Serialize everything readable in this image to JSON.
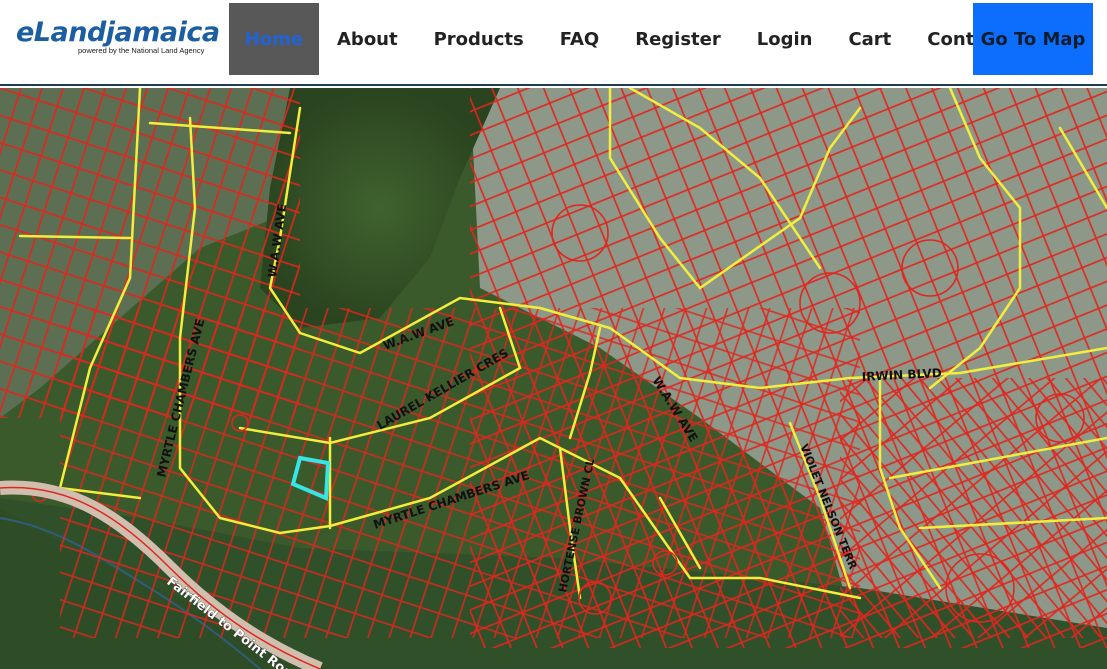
{
  "logo": {
    "name": "eLandjamaica",
    "tagline": "powered by the National Land Agency"
  },
  "nav": {
    "items": [
      {
        "label": "Home",
        "active": true
      },
      {
        "label": "About"
      },
      {
        "label": "Products"
      },
      {
        "label": "FAQ"
      },
      {
        "label": "Register"
      },
      {
        "label": "Login"
      },
      {
        "label": "Cart"
      },
      {
        "label": "Contact"
      }
    ],
    "cta": "Go To Map"
  },
  "map": {
    "roads": {
      "waw_ave_north": "W.A.W  AVE",
      "waw_ave_mid": "W.A.W  AVE",
      "waw_ave_east": "W.A.W  AVE",
      "myrtle_chambers_west": "MYRTLE CHAMBERS  AVE",
      "myrtle_chambers_south": "MYRTLE CHAMBERS  AVE",
      "laurel_kellier": "LAUREL KELLIER  CRES",
      "hortense_brown": "HORTENSE BROWN  CL",
      "violet_nelson": "VIOLET NELSON  TERR",
      "irwin": "IRWIN  BLVD",
      "fairfield": "Fairfield to Point Road"
    },
    "colors": {
      "parcel": "#e0261e",
      "road": "#f3ee3c",
      "selected_parcel": "#35e6e6",
      "forest": "#2f4f24",
      "cleared": "#8c9a86"
    }
  }
}
